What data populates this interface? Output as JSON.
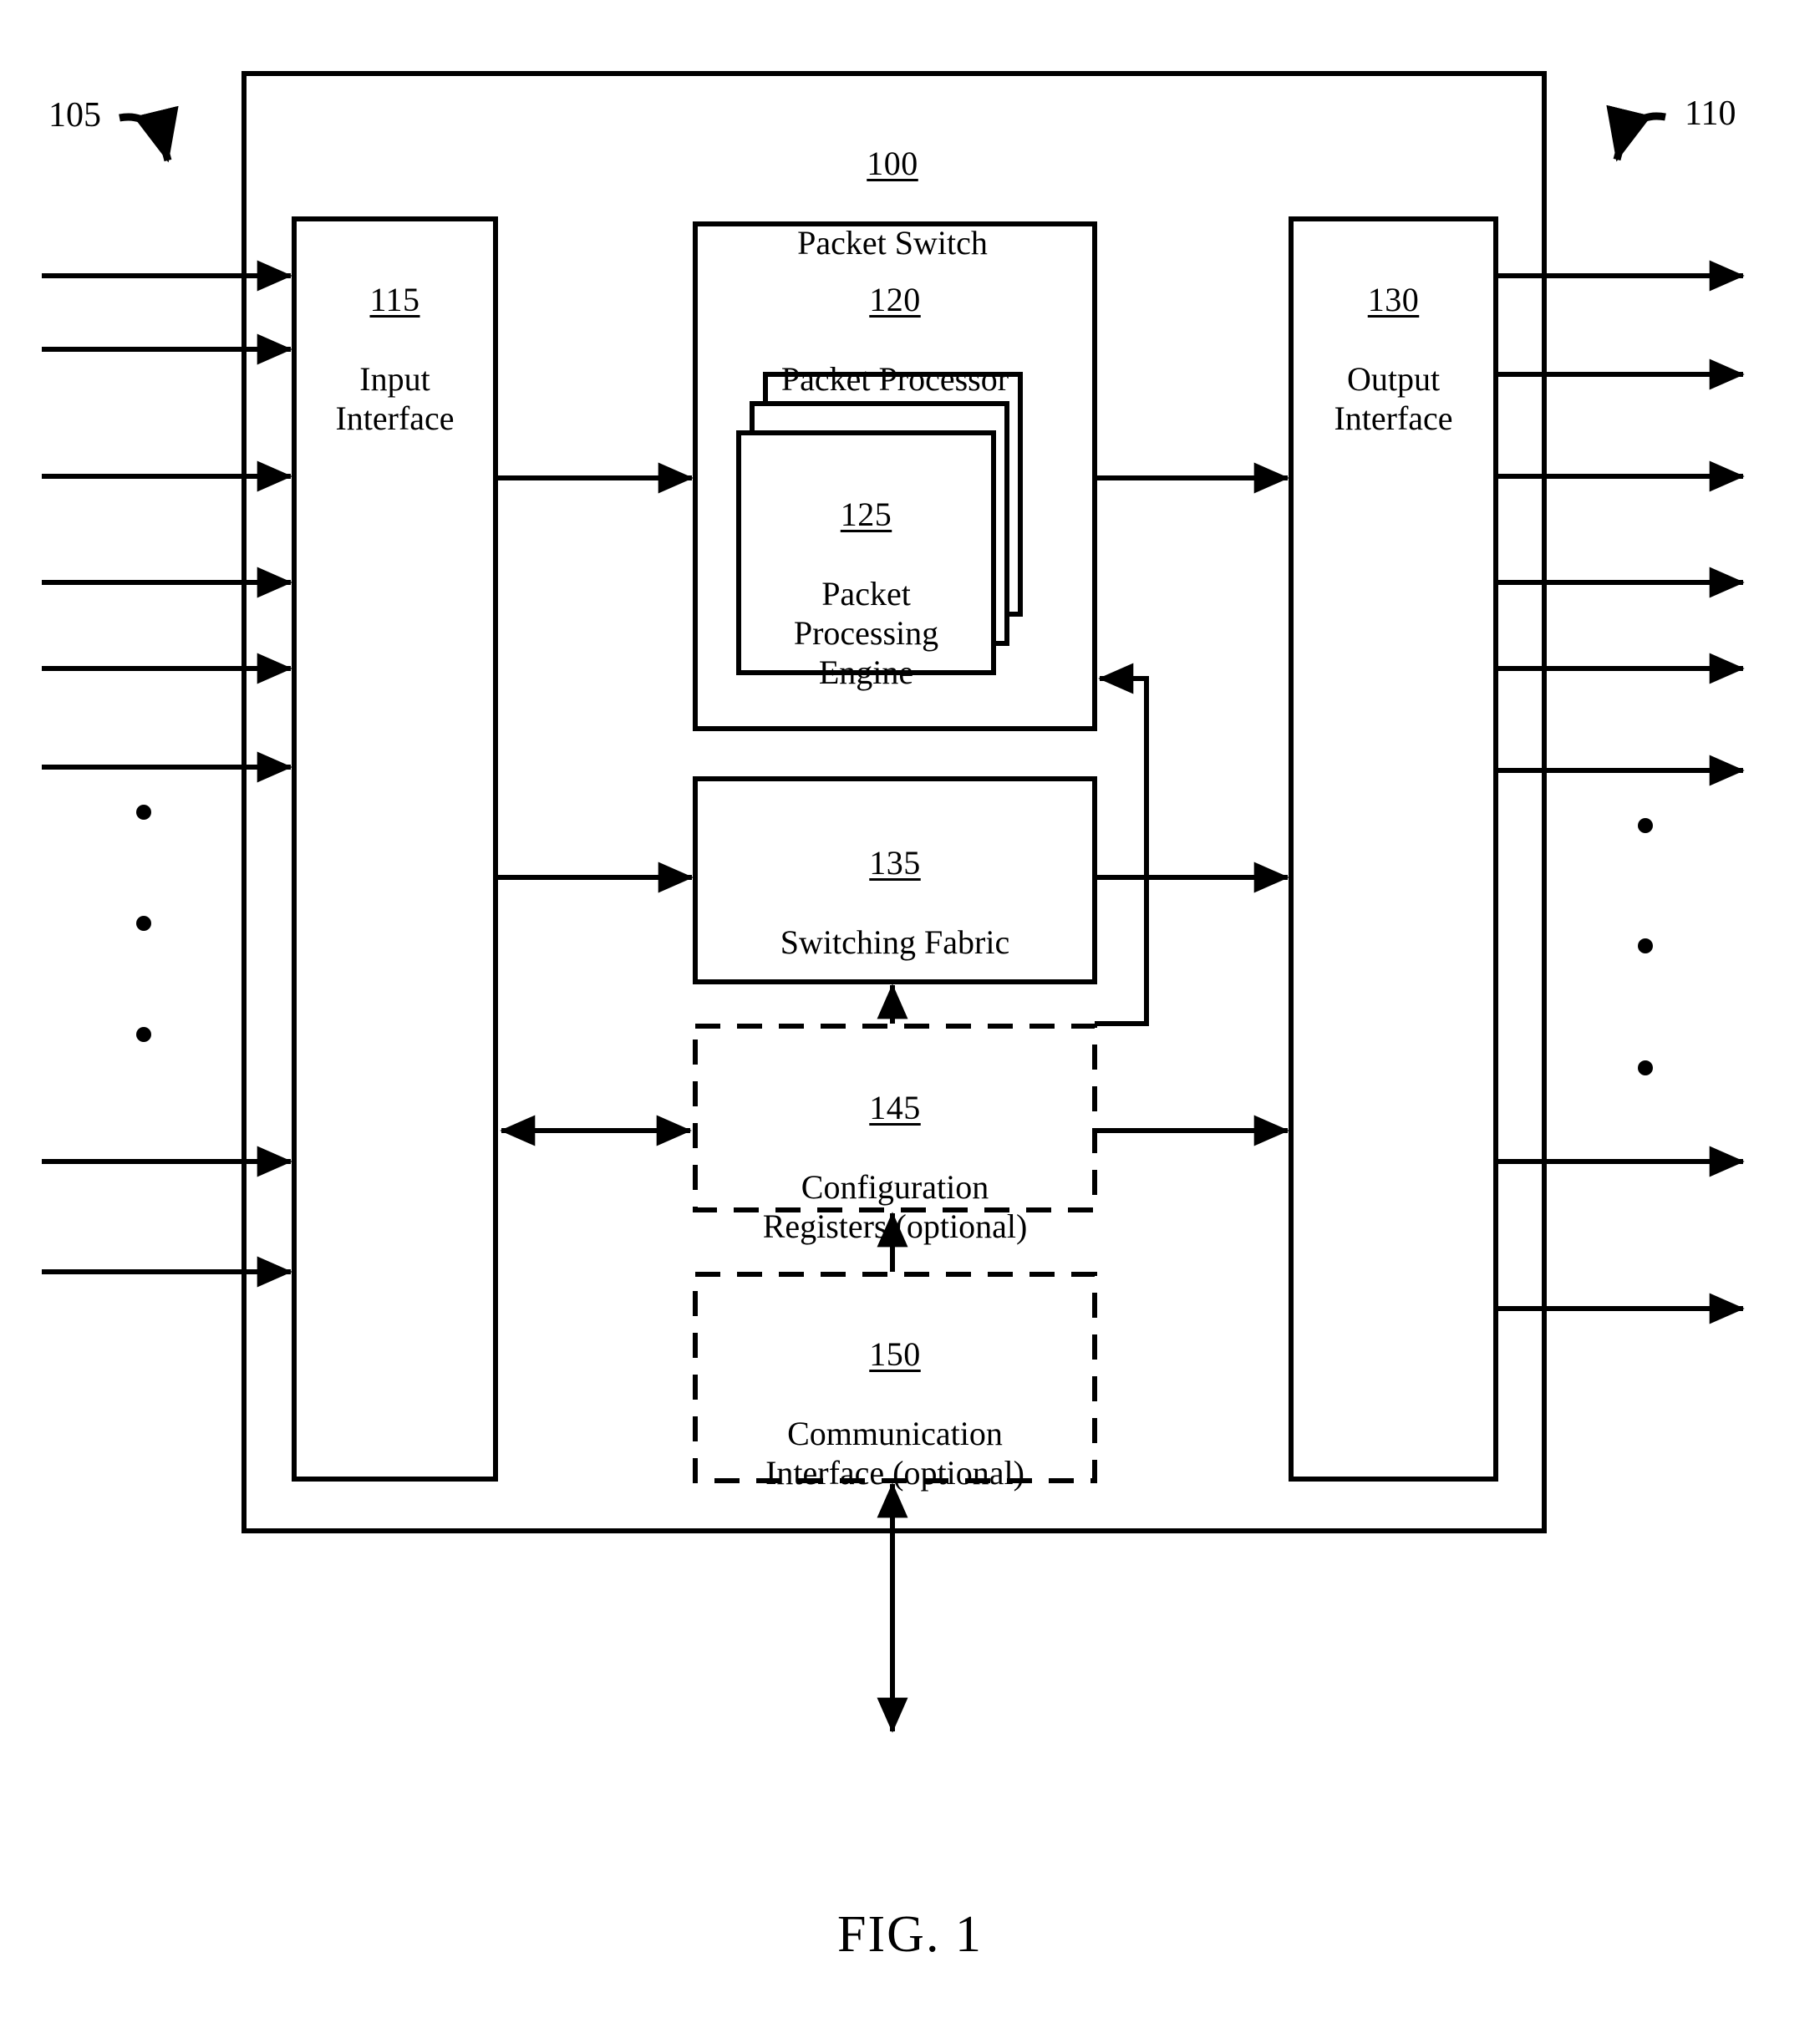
{
  "figure": {
    "caption": "FIG. 1",
    "outer_block": {
      "ref": "100",
      "title": "Packet Switch"
    },
    "lead_labels": {
      "input_side": "105",
      "output_side": "110"
    },
    "blocks": [
      {
        "key": "input_interface",
        "ref": "115",
        "title": "Input\nInterface"
      },
      {
        "key": "packet_processor",
        "ref": "120",
        "title": "Packet Processor"
      },
      {
        "key": "packet_processing_engine",
        "ref": "125",
        "title": "Packet\nProcessing\nEngine"
      },
      {
        "key": "output_interface",
        "ref": "130",
        "title": "Output\nInterface"
      },
      {
        "key": "switching_fabric",
        "ref": "135",
        "title": "Switching Fabric"
      },
      {
        "key": "configuration_registers",
        "ref": "145",
        "title": "Configuration\nRegisters (optional)",
        "style": "dashed"
      },
      {
        "key": "communication_interface",
        "ref": "150",
        "title": "Communication\nInterface (optional)",
        "style": "dashed"
      }
    ],
    "colors": {
      "stroke": "#000000",
      "background": "#ffffff"
    }
  }
}
